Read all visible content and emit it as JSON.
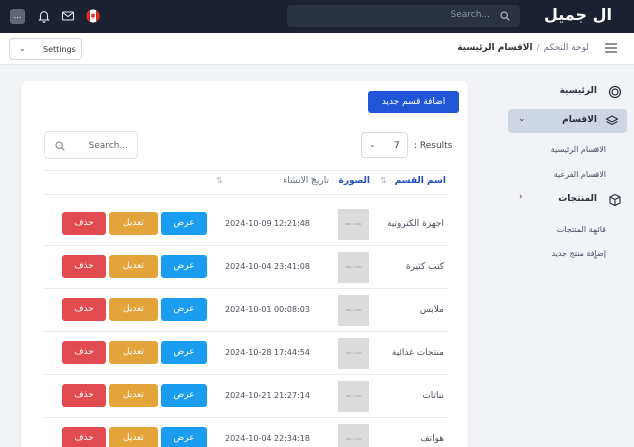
{
  "header": {
    "brand": "ال جميل",
    "search_placeholder": "Search...",
    "avatar_text": "..."
  },
  "subbar": {
    "settings_label": "Settings",
    "breadcrumb_parent": "لوحة التحكم",
    "breadcrumb_sep": "/",
    "breadcrumb_current": "الاقسام الرئيسية"
  },
  "sidebar": {
    "home": "الرئيسية",
    "sections": "الاقسام",
    "sub_main": "الاقسام الرئيسية",
    "sub_secondary": "الاقسام الفرعية",
    "products": "المنتجات",
    "sub_products_list": "قائمة المنتجات",
    "sub_add_product": "إضافة منتج جديد"
  },
  "content": {
    "add_button": "اضافة قسم جديد",
    "results_label": ": Results",
    "results_value": "7",
    "table_search_placeholder": "Search...",
    "columns": {
      "name": "اسم القسم",
      "image": "الصورة",
      "date": "تاريخ الانشاء"
    },
    "thumb_text": "480 × 400",
    "actions": {
      "view": "عرض",
      "edit": "تعديل",
      "delete": "حذف"
    },
    "rows": [
      {
        "name": "اجهزة الكترونية",
        "date": "2024-10-09 12:21:48"
      },
      {
        "name": "كتب كثيرة",
        "date": "2024-10-04 23:41:08"
      },
      {
        "name": "ملابس",
        "date": "2024-10-01 00:08:03"
      },
      {
        "name": "منتجات غذائية",
        "date": "2024-10-28 17:44:54"
      },
      {
        "name": "نباتات",
        "date": "2024-10-21 21:27:14"
      },
      {
        "name": "هواتف",
        "date": "2024-10-04 22:34:18"
      }
    ]
  },
  "colors": {
    "topbar": "#1b2130",
    "primary": "#1f55d6",
    "view": "#1a9cf0",
    "edit": "#e3a53b",
    "delete": "#e14b50"
  }
}
